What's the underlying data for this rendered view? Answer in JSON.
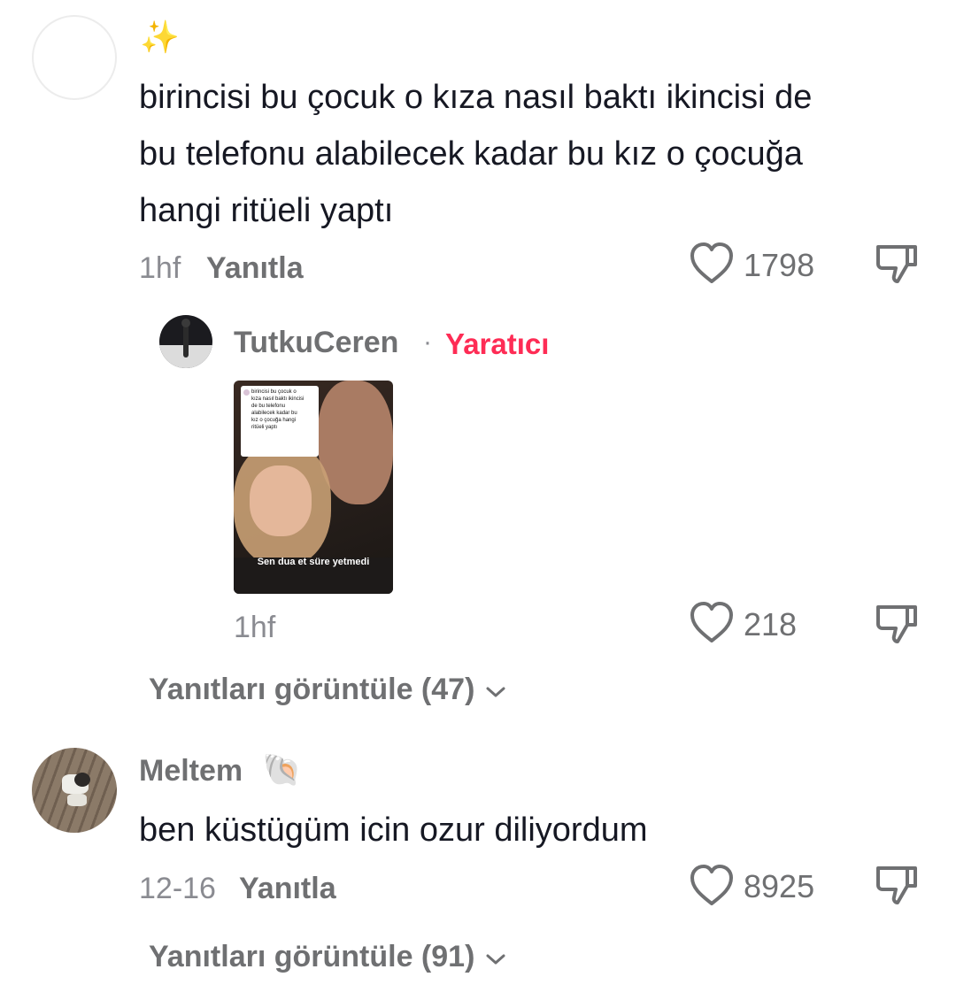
{
  "comments": [
    {
      "username_emoji": "✨",
      "text": "birincisi bu çocuk o kıza nasıl baktı ikincisi de bu telefonu alabilecek kadar bu kız o çocuğa hangi ritüeli yaptı",
      "text_lines": [
        "birincisi bu çocuk o kıza nasıl baktı ikincisi de",
        "bu telefonu alabilecek kadar bu kız o çocuğa",
        "hangi ritüeli yaptı"
      ],
      "time": "1hf",
      "reply_label": "Yanıtla",
      "likes": "1798"
    },
    {
      "username": "Meltem",
      "username_emoji": "🐚",
      "text": "ben küstügüm icin ozur diliyordum",
      "time": "12-16",
      "reply_label": "Yanıtla",
      "likes": "8925"
    }
  ],
  "creator_reply": {
    "username": "TutkuCeren",
    "separator": "·",
    "badge": "Yaratıcı",
    "video_caption": "Sen dua et süre yetmedi",
    "video_quote_lines": [
      "birincisi bu çocuk o",
      "kıza nasıl baktı ikincisi",
      "de bu telefonu",
      "alabilecek kadar bu",
      "kız o çocuğa hangi",
      "ritüeli yaptı"
    ],
    "time": "1hf",
    "likes": "218"
  },
  "view_replies": [
    {
      "label": "Yanıtları görüntüle (47)"
    },
    {
      "label": "Yanıtları görüntüle (91)"
    }
  ],
  "icons": {
    "like": "heart-outline-icon",
    "dislike": "thumbs-down-icon",
    "chevron": "chevron-down-icon"
  }
}
